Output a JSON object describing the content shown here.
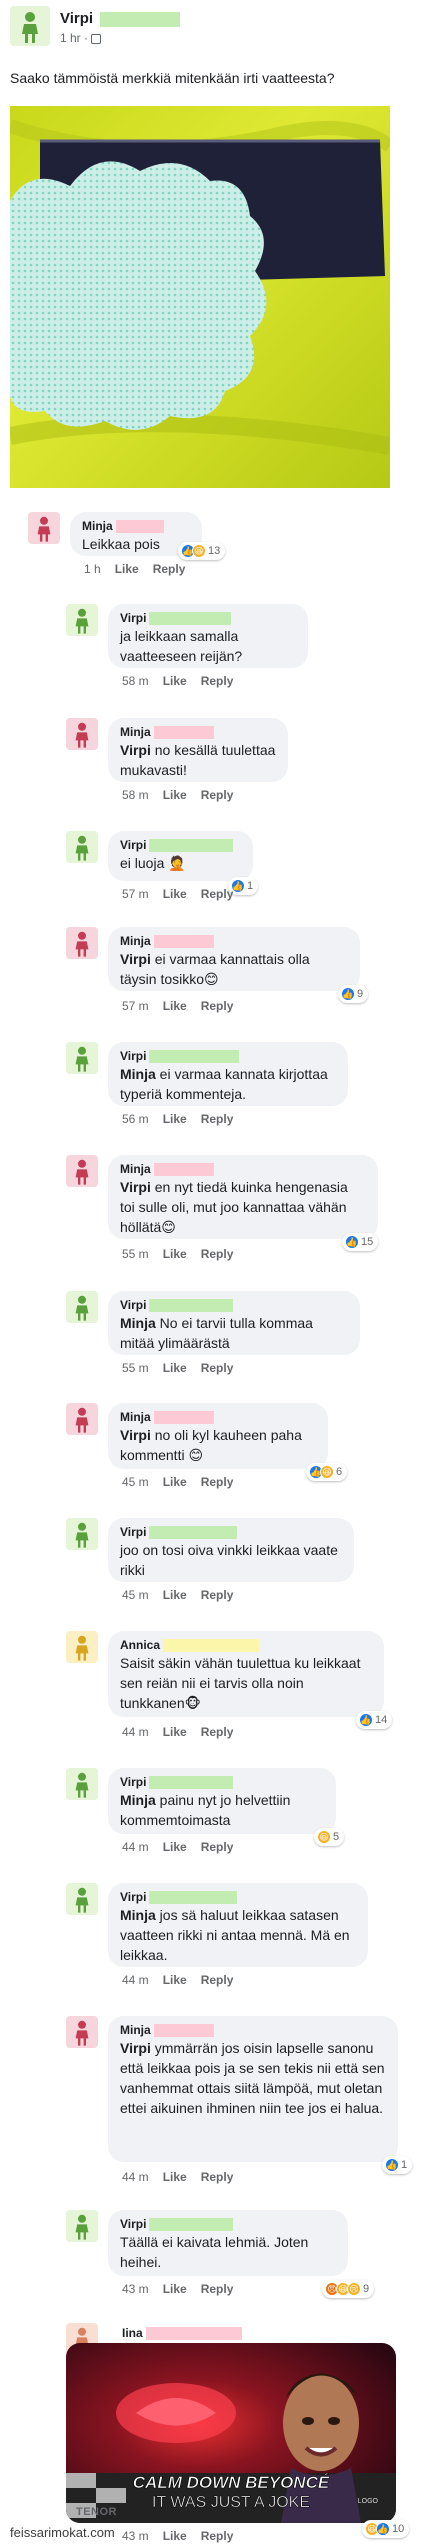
{
  "post": {
    "author": "Virpi",
    "meta": "1 hr · ",
    "text": "Saako tämmöistä merkkiä mitenkään irti vaatteesta?"
  },
  "comments": [
    {
      "author": "Minja",
      "text": "Leikkaa pois",
      "time": "1 h",
      "like": "Like",
      "reply": "Reply",
      "reactions": "13"
    },
    {
      "author": "Virpi",
      "text": "ja leikkaan samalla vaatteeseen reijän?",
      "time": "58 m",
      "like": "Like",
      "reply": "Reply"
    },
    {
      "author": "Minja",
      "mention": "Virpi",
      "text": " no kesällä tuulettaa mukavasti!",
      "time": "58 m",
      "like": "Like",
      "reply": "Reply"
    },
    {
      "author": "Virpi",
      "text": "ei luoja 🤦",
      "time": "57 m",
      "like": "Like",
      "reply": "Reply",
      "reactions": "1"
    },
    {
      "author": "Minja",
      "mention": "Virpi",
      "text": " ei varmaa kannattais olla täysin tosikko😊",
      "time": "57 m",
      "like": "Like",
      "reply": "Reply",
      "reactions": "9"
    },
    {
      "author": "Virpi",
      "mention": "Minja",
      "text": " ei varmaa kannata kirjottaa typeriä kommenteja.",
      "time": "56 m",
      "like": "Like",
      "reply": "Reply"
    },
    {
      "author": "Minja",
      "mention": "Virpi",
      "text": " en nyt tiedä kuinka hengenasia toi sulle oli, mut joo kannattaa vähän höllätä😊",
      "time": "55 m",
      "like": "Like",
      "reply": "Reply",
      "reactions": "15"
    },
    {
      "author": "Virpi",
      "mention": "Minja",
      "text": " No ei tarvii tulla kommaa mitää ylimäärästä",
      "time": "55 m",
      "like": "Like",
      "reply": "Reply"
    },
    {
      "author": "Minja",
      "mention": "Virpi",
      "text": " no oli kyl kauheen paha kommentti 😊",
      "time": "45 m",
      "like": "Like",
      "reply": "Reply",
      "reactions": "6"
    },
    {
      "author": "Virpi",
      "text": "joo on tosi oiva vinkki leikkaa vaate rikki",
      "time": "45 m",
      "like": "Like",
      "reply": "Reply"
    },
    {
      "author": "Annica",
      "text": "Saisit säkin vähän tuulettua ku leikkaat sen reiän nii ei tarvis olla noin tunkkanen🐵",
      "time": "44 m",
      "like": "Like",
      "reply": "Reply",
      "reactions": "14"
    },
    {
      "author": "Virpi",
      "mention": "Minja",
      "text": " painu nyt jo helvettiin kommemtoimasta",
      "time": "44 m",
      "like": "Like",
      "reply": "Reply",
      "reactions": "5"
    },
    {
      "author": "Virpi",
      "mention": "Minja",
      "text": " jos sä haluut leikkaa satasen vaatteen rikki ni antaa mennä. Mä en leikkaa.",
      "time": "44 m",
      "like": "Like",
      "reply": "Reply"
    },
    {
      "author": "Minja",
      "mention": "Virpi",
      "text": " ymmärrän jos oisin lapselle sanonu että leikkaa pois ja se sen tekis nii että sen vanhemmat ottais siitä lämpöä, mut oletan ettei aikuinen ihminen niin tee jos ei halua.",
      "time": "44 m",
      "like": "Like",
      "reply": "Reply",
      "reactions": "1"
    },
    {
      "author": "Virpi",
      "text": "Täällä ei kaivata lehmiä. Joten heihei.",
      "time": "43 m",
      "like": "Like",
      "reply": "Reply",
      "reactions": "9"
    },
    {
      "author": "Iina",
      "time": "43 m",
      "like": "Like",
      "reply": "Reply",
      "reactions": "10"
    }
  ],
  "gif": {
    "line1": "CALM DOWN BEYONCÉ",
    "line2": "IT WAS JUST A JOKE",
    "badge": "LOGO",
    "source": "TENOR"
  },
  "watermark": "feissarimokat.com",
  "colors": {
    "redact_green": "#c2ecb2",
    "redact_pink": "#fcc9d4",
    "redact_yellow": "#fbf6a9",
    "bubble": "#f0f2f5",
    "like_blue": "#1877f2"
  }
}
